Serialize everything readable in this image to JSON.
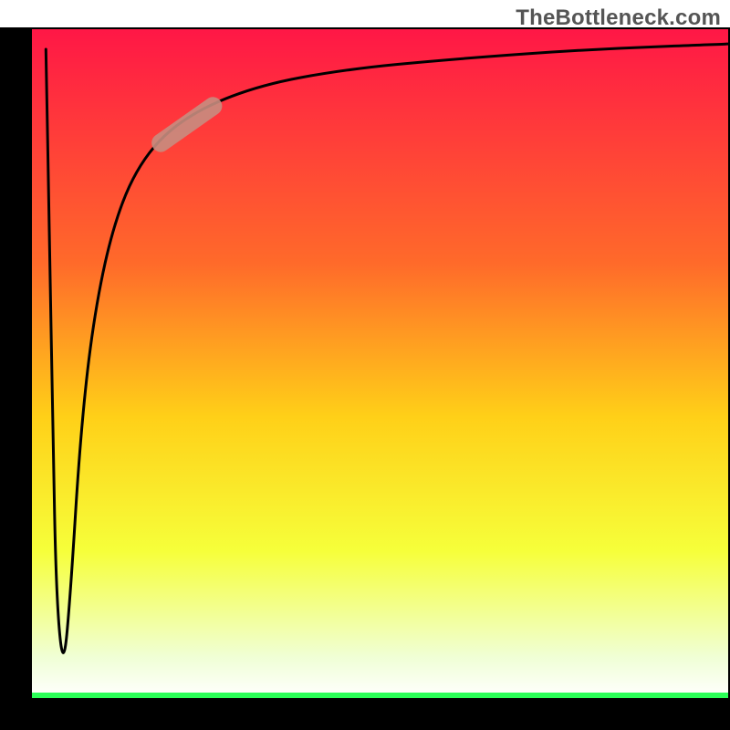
{
  "watermark": "TheBottleneck.com",
  "colors": {
    "grad_top": "#ff1746",
    "grad_mid_top": "#ff6a2a",
    "grad_mid": "#ffd018",
    "grad_mid_low": "#f6ff3a",
    "grad_low": "#f0ffd6",
    "grad_bottom_line": "#2aff57",
    "frame": "#000000",
    "curve": "#000000",
    "marker": "#c88d80"
  },
  "chart_data": {
    "type": "line",
    "title": "",
    "xlabel": "",
    "ylabel": "",
    "xlim": [
      0,
      100
    ],
    "ylim": [
      0,
      100
    ],
    "notes": "No axis tick labels, numeric ticks, or gridlines are visible. Values below are estimated from pixel positions — the plot area spans roughly x∈[0,100], y∈[0,100] with (0,0) at bottom-left of the inner square.",
    "curve": {
      "points": [
        {
          "x": 2.0,
          "y": 97.0
        },
        {
          "x": 2.5,
          "y": 70.0
        },
        {
          "x": 3.0,
          "y": 40.0
        },
        {
          "x": 3.5,
          "y": 15.0
        },
        {
          "x": 4.5,
          "y": 4.0
        },
        {
          "x": 5.5,
          "y": 15.0
        },
        {
          "x": 7.0,
          "y": 40.0
        },
        {
          "x": 9.0,
          "y": 58.0
        },
        {
          "x": 12.0,
          "y": 72.0
        },
        {
          "x": 16.0,
          "y": 81.0
        },
        {
          "x": 22.0,
          "y": 87.0
        },
        {
          "x": 32.0,
          "y": 91.5
        },
        {
          "x": 45.0,
          "y": 94.0
        },
        {
          "x": 60.0,
          "y": 95.5
        },
        {
          "x": 80.0,
          "y": 97.0
        },
        {
          "x": 100.0,
          "y": 97.8
        }
      ]
    },
    "marker_segment": {
      "description": "Short rounded highlight segment overlaid on the curve",
      "start": {
        "x": 18.5,
        "y": 83.0
      },
      "end": {
        "x": 26.0,
        "y": 88.5
      }
    }
  }
}
